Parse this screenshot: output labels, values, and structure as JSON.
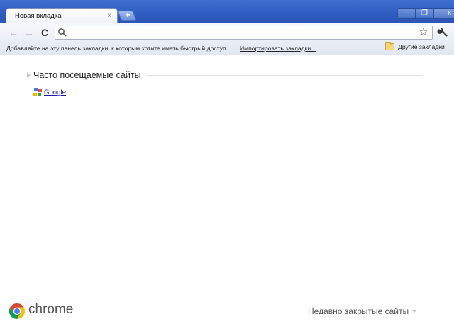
{
  "window": {
    "tab_title": "Новая вкладка",
    "tab_close_glyph": "×",
    "new_tab_glyph": "+",
    "minimize_glyph": "–",
    "maximize_glyph": "❐",
    "close_glyph": "x"
  },
  "toolbar": {
    "back_glyph": "←",
    "forward_glyph": "→",
    "reload_glyph": "C",
    "omnibox_value": "",
    "star_glyph": "☆"
  },
  "bookmarks_bar": {
    "hint_text": "Добавляйте на эту панель закладки, к которым хотите иметь быстрый доступ.",
    "import_link": "Импортировать закладки...",
    "other_bookmarks": "Другие закладки"
  },
  "most_visited": {
    "title": "Часто посещаемые сайты",
    "sites": [
      {
        "label": "Google"
      }
    ]
  },
  "footer": {
    "brand": "chrome",
    "recently_closed": "Недавно закрытые сайты"
  },
  "colors": {
    "titlebar": "#2f5cc0",
    "link": "#1a1aa6",
    "chrome_red": "#db4437",
    "chrome_green": "#0f9d58",
    "chrome_yellow": "#f4c20d",
    "chrome_blue": "#4285f4"
  },
  "icons": [
    "back-icon",
    "forward-icon",
    "reload-icon",
    "search-icon",
    "star-icon",
    "wrench-icon",
    "folder-icon",
    "google-favicon",
    "chrome-logo-icon"
  ]
}
